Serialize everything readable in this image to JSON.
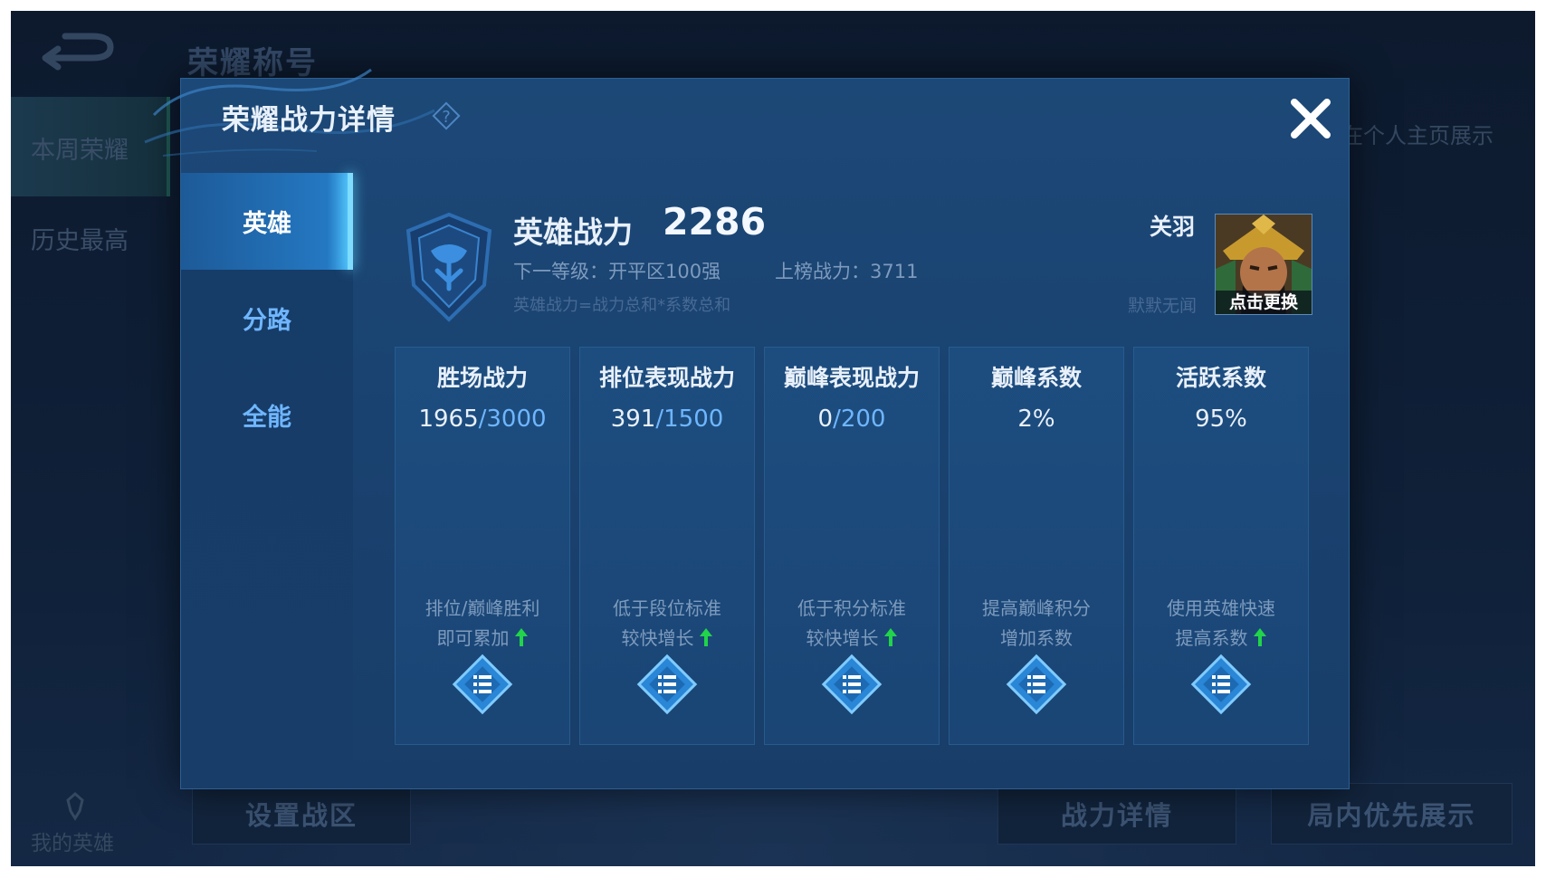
{
  "background": {
    "title": "荣耀称号",
    "sidebar_items": [
      "本周荣耀",
      "历史最高"
    ],
    "right_text": "在个人主页展示",
    "my_hero_label": "我的英雄",
    "buttons": {
      "set_region": "设置战区",
      "power_detail": "战力详情",
      "priority_display": "局内优先展示"
    }
  },
  "dialog": {
    "title": "荣耀战力详情",
    "tabs": [
      {
        "label": "英雄",
        "active": true
      },
      {
        "label": "分路",
        "active": false
      },
      {
        "label": "全能",
        "active": false
      }
    ],
    "hero_power_label": "英雄战力",
    "hero_power_value": "2286",
    "next_level": "下一等级：开平区100强",
    "rank_power": "上榜战力：3711",
    "formula": "英雄战力=战力总和*系数总和",
    "hero_name": "关羽",
    "hero_subtitle": "默默无闻",
    "change_label": "点击更换",
    "cards": [
      {
        "title": "胜场战力",
        "current": "1965",
        "max": "/3000",
        "hint_line1": "排位/巅峰胜利",
        "hint_line2": "即可累加",
        "up_arrow": true
      },
      {
        "title": "排位表现战力",
        "current": "391",
        "max": "/1500",
        "hint_line1": "低于段位标准",
        "hint_line2": "较快增长",
        "up_arrow": true
      },
      {
        "title": "巅峰表现战力",
        "current": "0",
        "max": "/200",
        "hint_line1": "低于积分标准",
        "hint_line2": "较快增长",
        "up_arrow": true
      },
      {
        "title": "巅峰系数",
        "current": "2%",
        "max": "",
        "hint_line1": "提高巅峰积分",
        "hint_line2": "增加系数",
        "up_arrow": false
      },
      {
        "title": "活跃系数",
        "current": "95%",
        "max": "",
        "hint_line1": "使用英雄快速",
        "hint_line2": "提高系数",
        "up_arrow": true
      }
    ]
  },
  "colors": {
    "accent_blue": "#6fb6ff",
    "active_tab": "#2478c2",
    "up_arrow": "#21d44a"
  },
  "icons": [
    "back-arrow-icon",
    "help-icon",
    "close-icon",
    "shield-emblem-icon",
    "list-icon",
    "up-arrow-icon"
  ]
}
